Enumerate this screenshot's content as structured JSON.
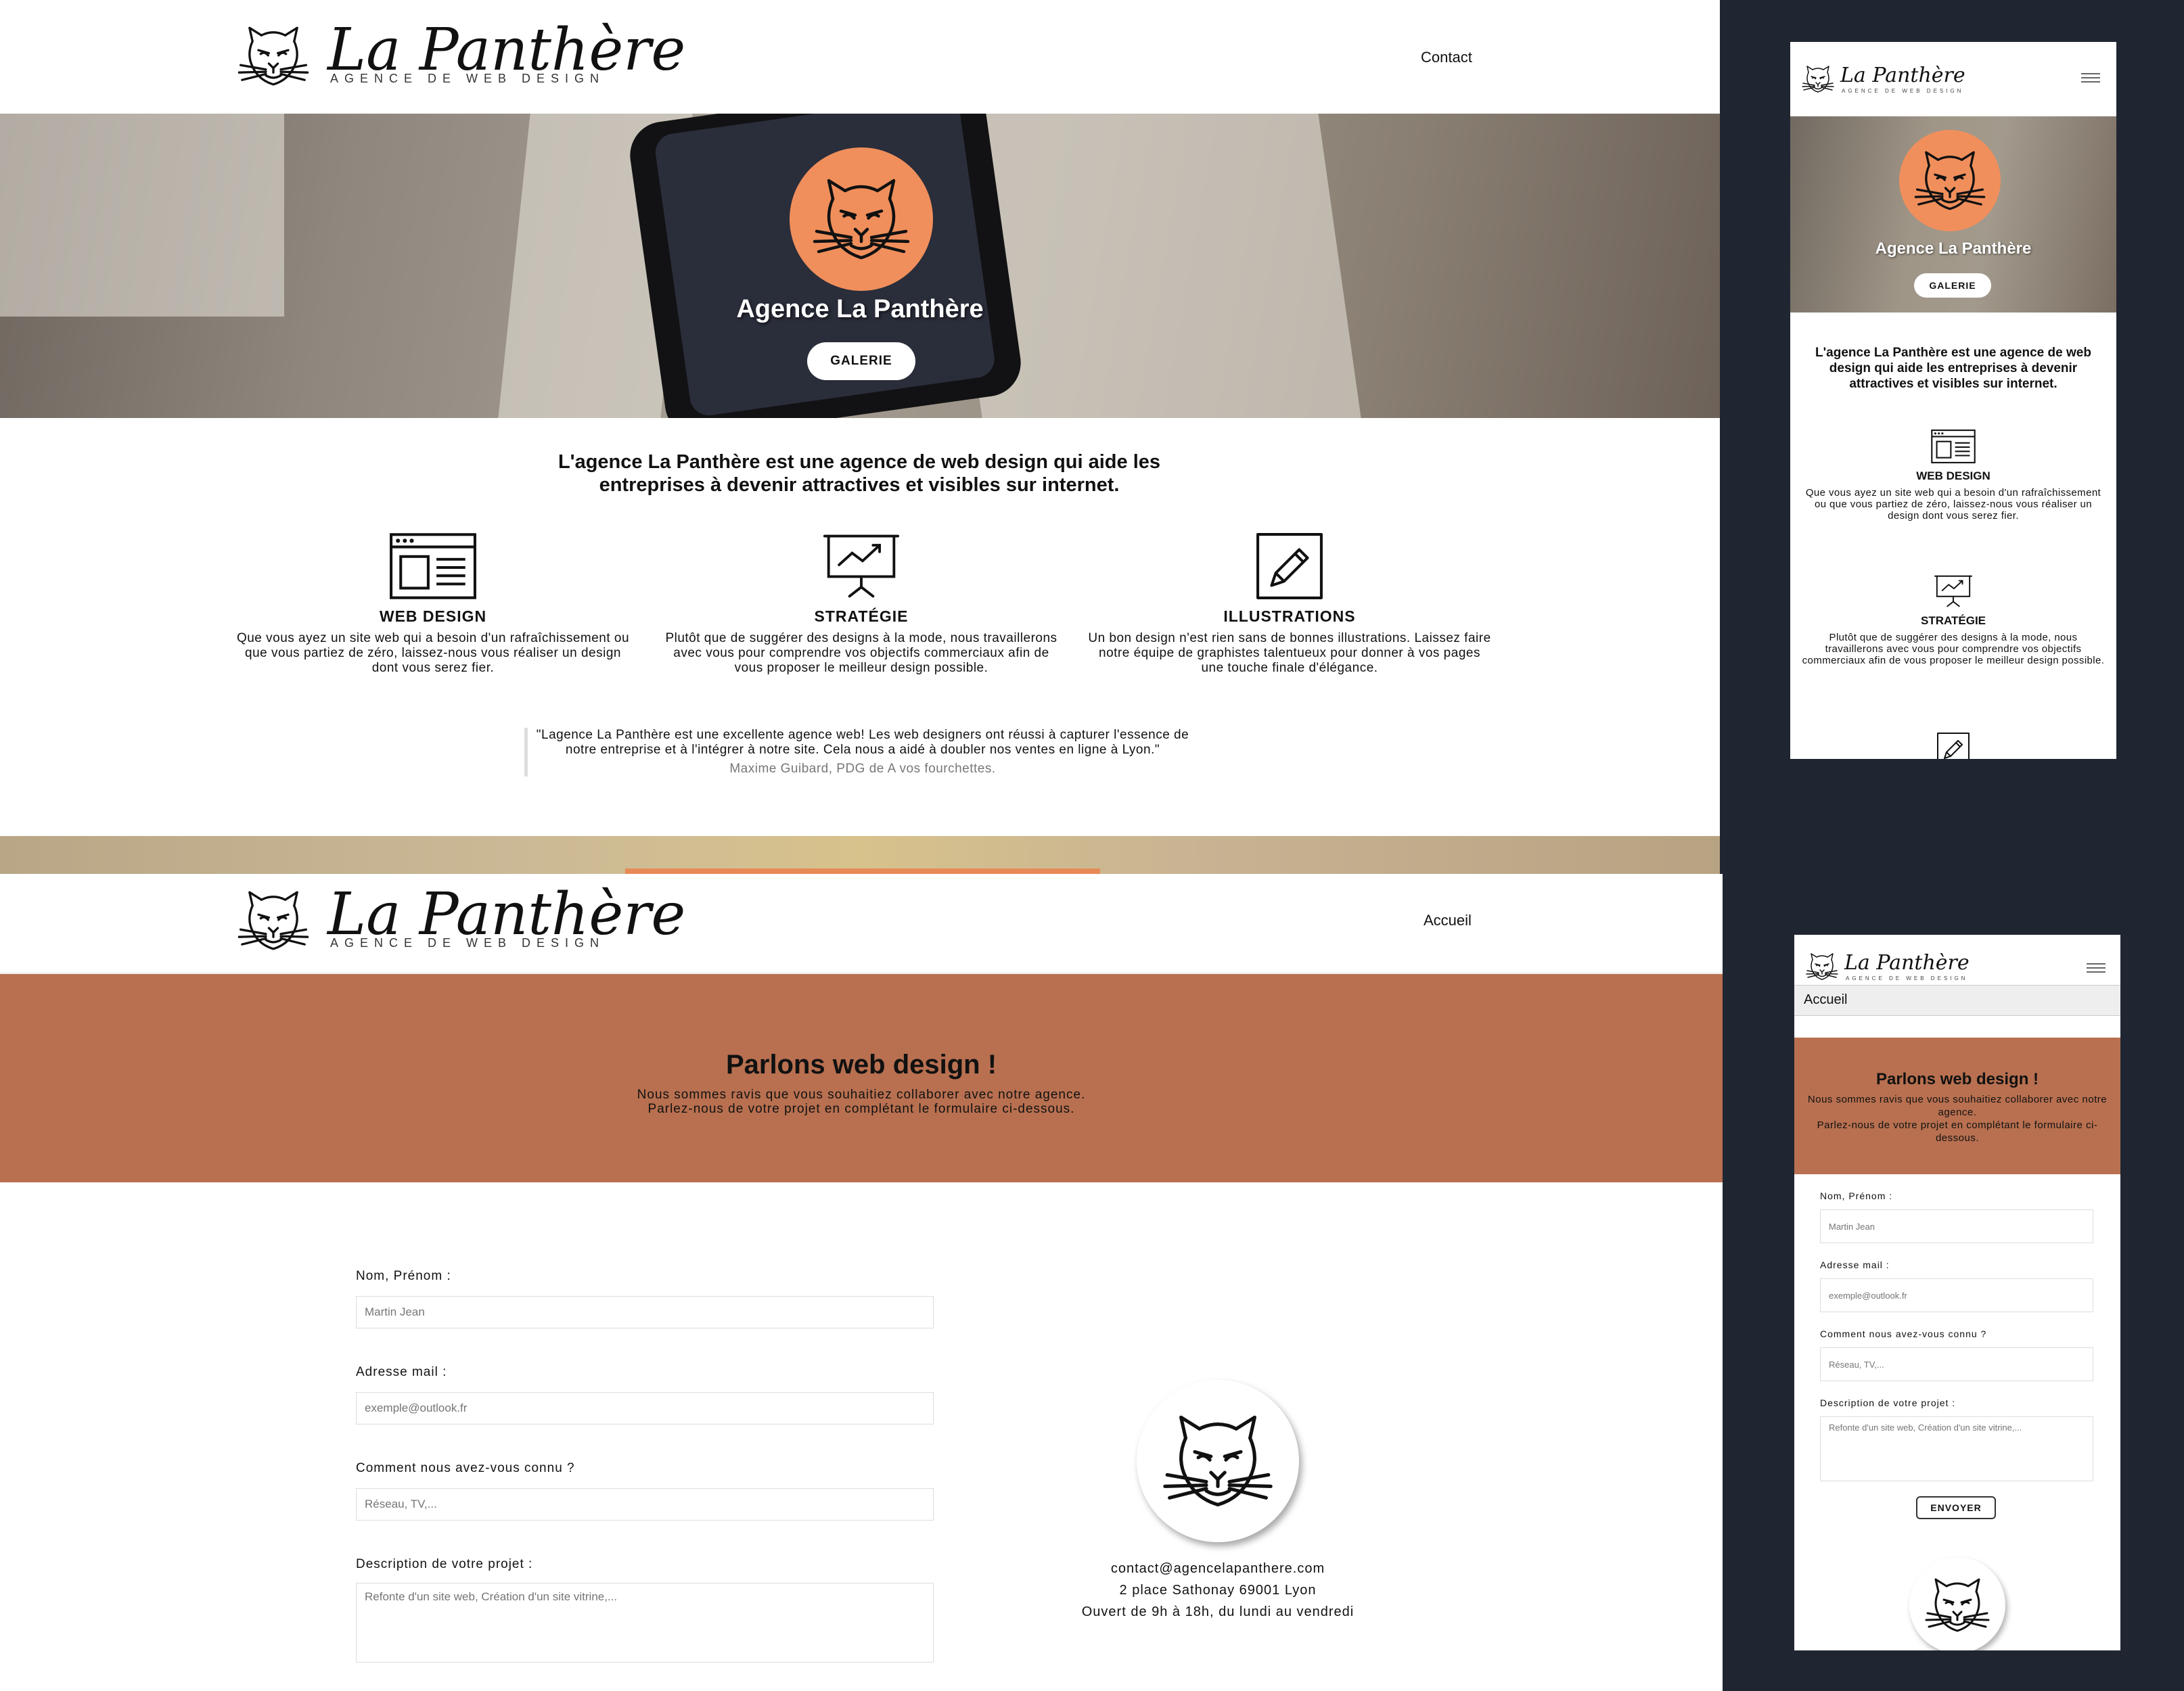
{
  "brand": {
    "name": "La Panthère",
    "tagline": "AGENCE DE WEB DESIGN"
  },
  "home": {
    "nav_contact": "Contact",
    "hero_title": "Agence La Panthère",
    "gallery_button": "GALERIE",
    "intro": "L'agence La Panthère est une agence de web design qui aide les entreprises à devenir attractives et visibles sur internet.",
    "services": [
      {
        "icon": "browser-window-icon",
        "title": "WEB DESIGN",
        "text": "Que vous ayez un site web qui a besoin d'un rafraîchissement ou que vous partiez de zéro, laissez-nous vous réaliser un design dont vous serez fier."
      },
      {
        "icon": "presentation-chart-icon",
        "title": "STRATÉGIE",
        "text": "Plutôt que de suggérer des designs à la mode, nous travaillerons avec vous pour comprendre vos objectifs commerciaux afin de vous proposer le meilleur design possible."
      },
      {
        "icon": "pencil-square-icon",
        "title": "ILLUSTRATIONS",
        "text": "Un bon design n'est rien sans de bonnes illustrations. Laissez faire notre équipe de graphistes talentueux pour donner à vos pages une touche finale d'élégance."
      }
    ],
    "testimonial": {
      "quote": "\"Lagence La Panthère est une excellente agence web! Les web designers ont réussi à capturer l'essence de notre entreprise et à l'intégrer à notre site. Cela nous a aidé à doubler nos ventes en ligne à Lyon.\"",
      "author": "Maxime Guibard, PDG de A vos fourchettes."
    }
  },
  "contact": {
    "nav_home": "Accueil",
    "heading": "Parlons web design !",
    "subtitle_line1": "Nous sommes ravis que vous souhaitiez collaborer avec notre agence.",
    "subtitle_line2": "Parlez-nous de votre projet en complétant le formulaire ci-dessous.",
    "fields": {
      "name_label": "Nom, Prénom :",
      "name_placeholder": "Martin Jean",
      "email_label": "Adresse mail :",
      "email_placeholder": "exemple@outlook.fr",
      "source_label": "Comment nous avez-vous connu ?",
      "source_placeholder": "Réseau, TV,...",
      "project_label": "Description de votre projet :",
      "project_placeholder": "Refonte d'un site web, Création d'un site vitrine,..."
    },
    "send_button": "ENVOYER",
    "email": "contact@agencelapanthere.com",
    "address": "2 place Sathonay 69001 Lyon",
    "hours": "Ouvert de 9h à 18h, du lundi au vendredi"
  },
  "colors": {
    "accent": "#f08f5c",
    "band": "#b87050",
    "backdrop": "#202631"
  }
}
